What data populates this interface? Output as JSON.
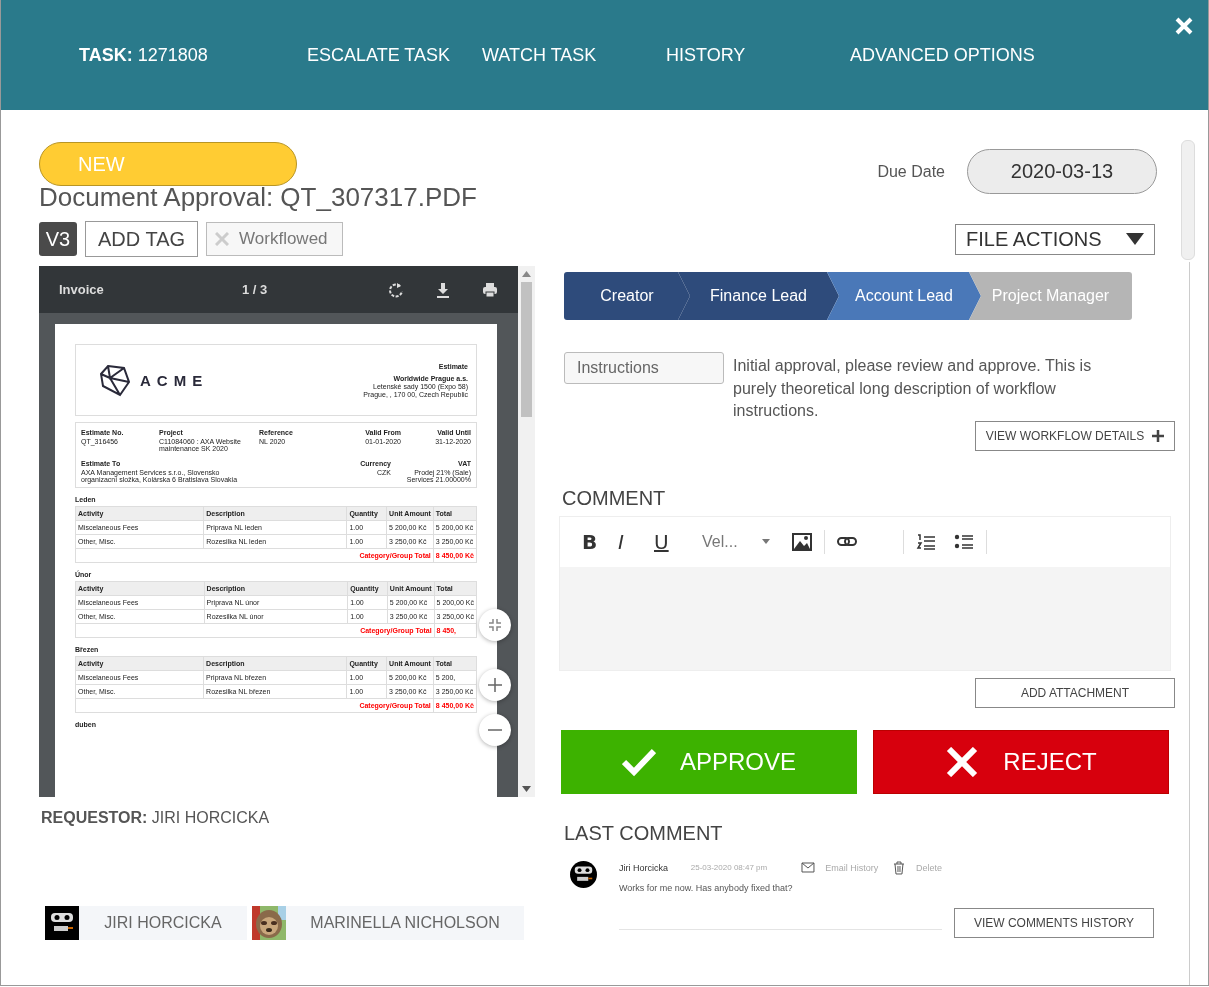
{
  "header": {
    "nav": [
      {
        "label": "**TASK:** 1271808"
      },
      {
        "label": "ESCALATE TASK"
      },
      {
        "label": "WATCH TASK"
      },
      {
        "label": "HISTORY"
      },
      {
        "label": "ADVANCED OPTIONS"
      }
    ]
  },
  "status": "NEW",
  "due_date": {
    "label": "Due Date",
    "value": "2020-03-13"
  },
  "title": "Document Approval: QT_307317.PDF",
  "version": "V3",
  "add_tag": "ADD TAG",
  "tags": [
    {
      "label": "Workflowed"
    }
  ],
  "file_actions": "FILE ACTIONS",
  "viewer": {
    "title": "Invoice",
    "page": "1 / 3",
    "document": {
      "logo": "ACME",
      "label": "Estimate",
      "company": "Worldwide Prague a.s.",
      "address": [
        "Letenské sady 1500 (Expo 58)",
        "Prague, , 170 00, Czech Republic"
      ],
      "fields": [
        {
          "label": "Estimate No.",
          "lines": [
            "QT_316456"
          ]
        },
        {
          "label": "Project",
          "lines": [
            "C11084060 : AXA Website",
            "maintenance SK 2020"
          ]
        },
        {
          "label": "Reference",
          "lines": [
            "NL 2020"
          ]
        },
        {
          "label": "Valid From",
          "lines": [
            "01-01-2020"
          ]
        },
        {
          "label": "Valid Until",
          "lines": [
            "31-12-2020"
          ]
        }
      ],
      "bill": [
        {
          "label": "Estimate To",
          "lines": [
            "AXA Management Services s.r.o., Slovensko",
            "organizacní složka, Kolárska 6 Bratislava Slovakia"
          ]
        },
        {
          "label": "Currency",
          "lines": [
            "CZK"
          ]
        },
        {
          "label": "VAT",
          "lines": [
            "Prodej 21% (Sale)",
            "Services 21.00000%"
          ]
        }
      ],
      "groups": [
        {
          "name": "Leden",
          "columns": [
            "Activity",
            "Description",
            "Quantity",
            "Unit Amount",
            "Total"
          ],
          "rows": [
            [
              "Miscelaneous Fees",
              "Priprava NL leden",
              "1.00",
              "5 200,00 Kč",
              "5 200,00 Kč"
            ],
            [
              "Other, Misc.",
              "Rozesilka NL leden",
              "1.00",
              "3 250,00 Kč",
              "3 250,00 Kč"
            ]
          ],
          "total_label": "Category/Group Total",
          "total": "8 450,00 Kč"
        },
        {
          "name": "Únor",
          "columns": [
            "Activity",
            "Description",
            "Quantity",
            "Unit Amount",
            "Total"
          ],
          "rows": [
            [
              "Miscelaneous Fees",
              "Priprava NL únor",
              "1.00",
              "5 200,00 Kč",
              "5 200,00 Kč"
            ],
            [
              "Other, Misc.",
              "Rozesilka NL únor",
              "1.00",
              "3 250,00 Kč",
              "3 250,00 Kč"
            ]
          ],
          "total_label": "Category/Group Total",
          "total": "8 450,"
        },
        {
          "name": "Březen",
          "columns": [
            "Activity",
            "Description",
            "Quantity",
            "Unit Amount",
            "Total"
          ],
          "rows": [
            [
              "Miscelaneous Fees",
              "Priprava NL březen",
              "1.00",
              "5 200,00 Kč",
              "5 200,"
            ],
            [
              "Other, Misc.",
              "Rozesilka NL březen",
              "1.00",
              "3 250,00 Kč",
              "3 250,00 Kč"
            ]
          ],
          "total_label": "Category/Group Total",
          "total": "8 450,00 Kč"
        },
        {
          "name": "duben"
        }
      ]
    }
  },
  "workflow": [
    {
      "label": "Creator",
      "completed": true,
      "selected": false
    },
    {
      "label": "Finance Lead",
      "completed": true,
      "selected": false
    },
    {
      "label": "Account Lead",
      "completed": false,
      "selected": true
    },
    {
      "label": "Project Manager",
      "completed": false,
      "selected": false
    }
  ],
  "instructions": {
    "label": "Instructions",
    "text": "Initial approval, please review and approve. This is purely theoretical long description of workflow instructions.",
    "details_button": "VIEW WORKFLOW DETAILS"
  },
  "comment": {
    "heading": "COMMENT",
    "toolbar": {
      "bold": "B",
      "italic": "I",
      "underline": "U",
      "font": "Vel..."
    },
    "attachment_button": "ADD ATTACHMENT"
  },
  "approve": "APPROVE",
  "reject": "REJECT",
  "requestor": "**REQUESTOR:** JIRI HORCICKA",
  "participants": [
    {
      "name": "JIRI HORCICKA",
      "kind": "robot"
    },
    {
      "name": "MARINELLA NICHOLSON",
      "kind": "picture"
    }
  ],
  "last_comment": {
    "heading": "LAST COMMENT",
    "author": "Jiri Horcicka",
    "time": "25-03-2020 08:47 pm",
    "email_history": "Email History",
    "delete": "Delete",
    "text": "Works for me now. Has anybody fixed that?",
    "history_button": "VIEW COMMENTS HISTORY"
  }
}
